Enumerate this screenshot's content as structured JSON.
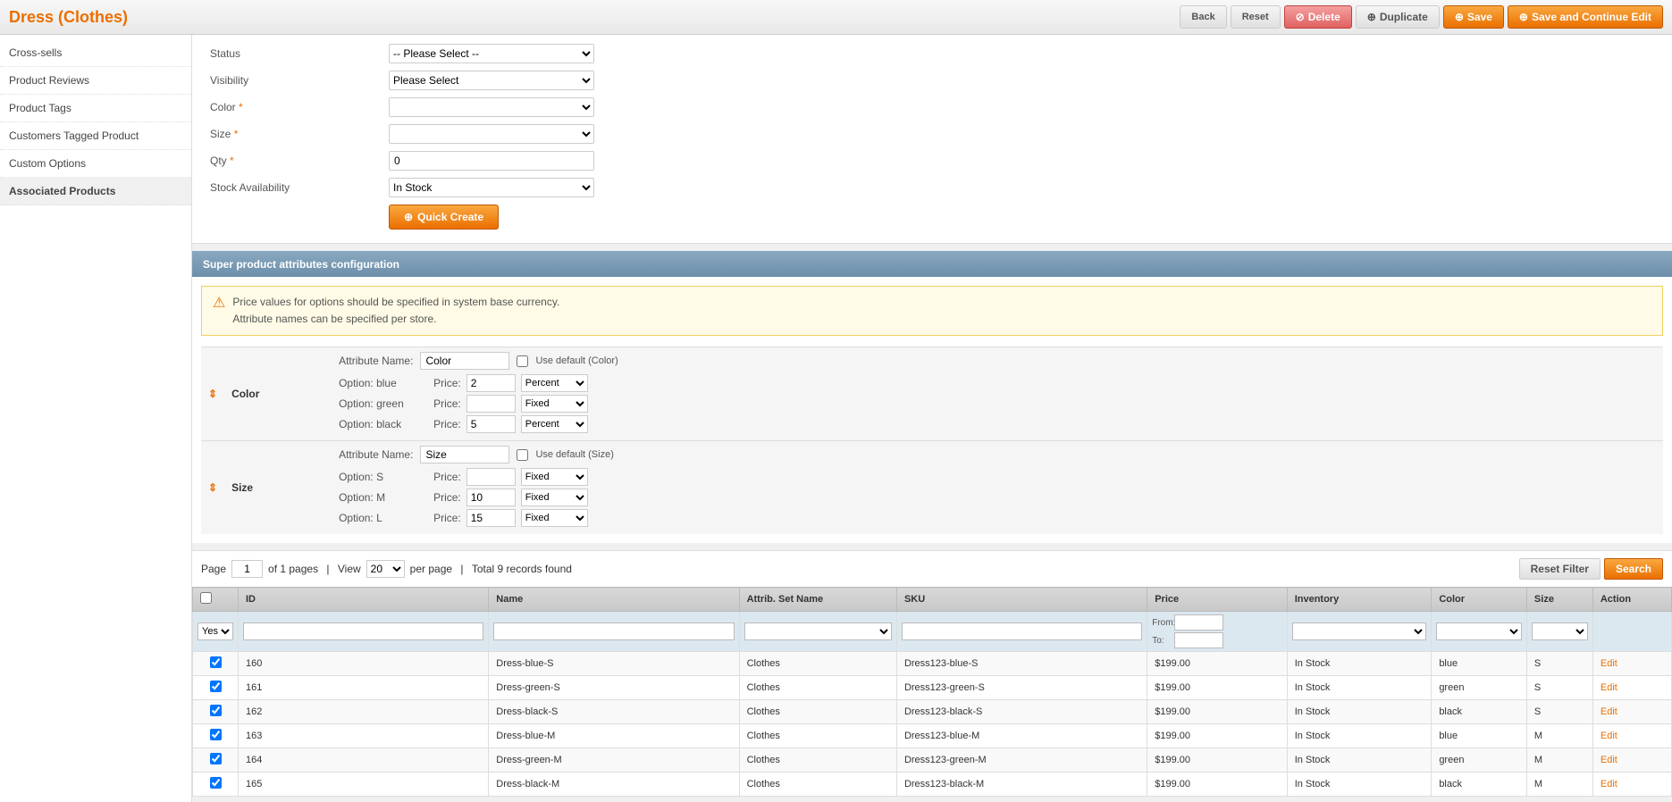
{
  "header": {
    "title": "Dress (Clothes)",
    "buttons": {
      "back": "Back",
      "reset": "Reset",
      "delete": "Delete",
      "duplicate": "Duplicate",
      "save": "Save",
      "save_continue": "Save and Continue Edit"
    }
  },
  "sidebar": {
    "items": [
      {
        "label": "Cross-sells",
        "active": false
      },
      {
        "label": "Product Reviews",
        "active": false
      },
      {
        "label": "Product Tags",
        "active": false
      },
      {
        "label": "Customers Tagged Product",
        "active": false
      },
      {
        "label": "Custom Options",
        "active": false
      },
      {
        "label": "Associated Products",
        "active": true
      }
    ]
  },
  "form": {
    "status_label": "Status",
    "status_placeholder": "-- Please Select --",
    "visibility_label": "Visibility",
    "visibility_placeholder": "Please Select",
    "color_label": "Color",
    "color_required": true,
    "size_label": "Size",
    "size_required": true,
    "qty_label": "Qty",
    "qty_required": true,
    "qty_value": "0",
    "stock_label": "Stock Availability",
    "stock_value": "In Stock",
    "quick_create_label": "Quick Create"
  },
  "config_section": {
    "title": "Super product attributes configuration",
    "notice_line1": "Price values for options should be specified in system base currency.",
    "notice_line2": "Attribute names can be specified per store.",
    "attributes": [
      {
        "move": "⇕",
        "name": "Color",
        "attr_name_label": "Attribute Name:",
        "attr_name_value": "Color",
        "use_default_label": "Use default (Color)",
        "options": [
          {
            "label": "Option: blue",
            "price_label": "Price:",
            "price_value": "2",
            "price_type": "Percent"
          },
          {
            "label": "Option: green",
            "price_label": "Price:",
            "price_value": "",
            "price_type": "Fixed"
          },
          {
            "label": "Option: black",
            "price_label": "Price:",
            "price_value": "5",
            "price_type": "Percent"
          }
        ]
      },
      {
        "move": "⇕",
        "name": "Size",
        "attr_name_label": "Attribute Name:",
        "attr_name_value": "Size",
        "use_default_label": "Use default (Size)",
        "options": [
          {
            "label": "Option: S",
            "price_label": "Price:",
            "price_value": "",
            "price_type": "Fixed"
          },
          {
            "label": "Option: M",
            "price_label": "Price:",
            "price_value": "10",
            "price_type": "Fixed"
          },
          {
            "label": "Option: L",
            "price_label": "Price:",
            "price_value": "15",
            "price_type": "Fixed"
          }
        ]
      }
    ]
  },
  "pagination": {
    "page_label": "Page",
    "page_value": "1",
    "of_pages": "of 1 pages",
    "view_label": "View",
    "view_value": "20",
    "per_page_label": "per page",
    "total_label": "Total 9 records found",
    "reset_filter_label": "Reset Filter",
    "search_label": "Search"
  },
  "grid": {
    "columns": [
      "",
      "ID",
      "Name",
      "Attrib. Set Name",
      "SKU",
      "Price",
      "Inventory",
      "Color",
      "Size",
      "Action"
    ],
    "filter_yes_options": [
      "Yes"
    ],
    "price_types": [
      "Percent",
      "Fixed"
    ],
    "rows": [
      {
        "id": "160",
        "name": "Dress-blue-S",
        "attrib": "Clothes",
        "sku": "Dress123-blue-S",
        "price": "$199.00",
        "inventory": "In Stock",
        "color": "blue",
        "size": "S",
        "action": "Edit"
      },
      {
        "id": "161",
        "name": "Dress-green-S",
        "attrib": "Clothes",
        "sku": "Dress123-green-S",
        "price": "$199.00",
        "inventory": "In Stock",
        "color": "green",
        "size": "S",
        "action": "Edit"
      },
      {
        "id": "162",
        "name": "Dress-black-S",
        "attrib": "Clothes",
        "sku": "Dress123-black-S",
        "price": "$199.00",
        "inventory": "In Stock",
        "color": "black",
        "size": "S",
        "action": "Edit"
      },
      {
        "id": "163",
        "name": "Dress-blue-M",
        "attrib": "Clothes",
        "sku": "Dress123-blue-M",
        "price": "$199.00",
        "inventory": "In Stock",
        "color": "blue",
        "size": "M",
        "action": "Edit"
      },
      {
        "id": "164",
        "name": "Dress-green-M",
        "attrib": "Clothes",
        "sku": "Dress123-green-M",
        "price": "$199.00",
        "inventory": "In Stock",
        "color": "green",
        "size": "M",
        "action": "Edit"
      },
      {
        "id": "165",
        "name": "Dress-black-M",
        "attrib": "Clothes",
        "sku": "Dress123-black-M",
        "price": "$199.00",
        "inventory": "In Stock",
        "color": "black",
        "size": "M",
        "action": "Edit"
      }
    ]
  }
}
